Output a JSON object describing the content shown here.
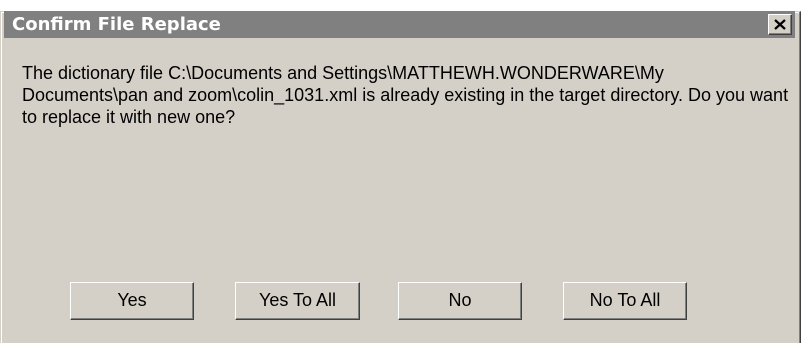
{
  "dialog": {
    "title": "Confirm File Replace",
    "message": "The dictionary file C:\\Documents and Settings\\MATTHEWH.WONDERWARE\\My Documents\\pan and zoom\\colin_1031.xml is already existing in the target directory. Do you want to replace it with new one?",
    "buttons": {
      "yes": "Yes",
      "yes_to_all": "Yes To All",
      "no": "No",
      "no_to_all": "No To All"
    },
    "close_icon": "close-icon"
  },
  "colors": {
    "title_bar": "#808080",
    "title_text": "#ffffff",
    "face": "#d4d0c8"
  }
}
